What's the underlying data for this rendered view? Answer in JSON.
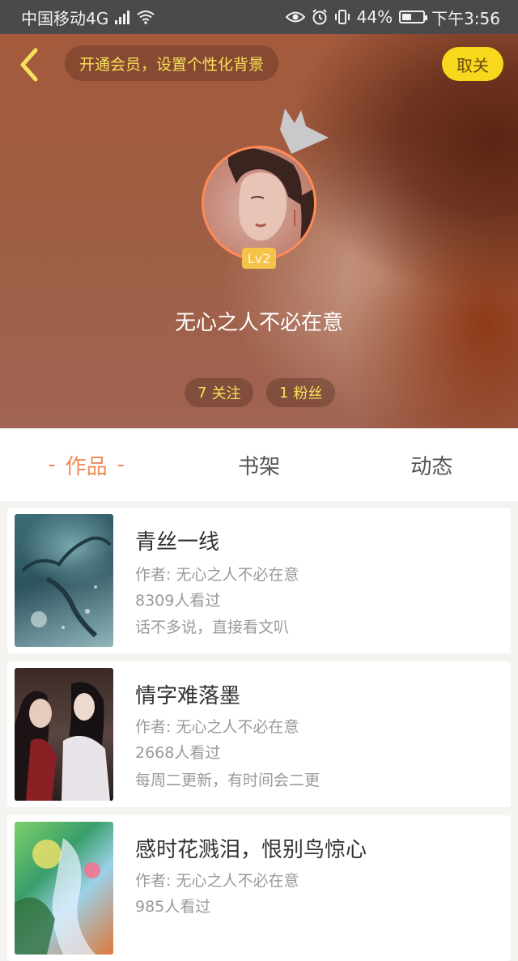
{
  "status_bar": {
    "carrier": "中国移动4G",
    "network_badge": "4G",
    "battery_percent": "44%",
    "battery_level": 0.44,
    "time": "下午3:56",
    "icons": [
      "signal-icon",
      "wifi-icon",
      "eye-icon",
      "alarm-icon",
      "vibrate-icon",
      "battery-icon"
    ]
  },
  "header": {
    "vip_prompt": "开通会员，设置个性化背景",
    "follow_button": "取关",
    "level_badge": "Lv2",
    "username": "无心之人不必在意",
    "following": {
      "count": "7",
      "label": "关注"
    },
    "followers": {
      "count": "1",
      "label": "粉丝"
    }
  },
  "tabs": [
    {
      "label": "作品",
      "active": true,
      "decoration": "-"
    },
    {
      "label": "书架",
      "active": false
    },
    {
      "label": "动态",
      "active": false
    }
  ],
  "works": [
    {
      "title": "青丝一线",
      "author": "作者: 无心之人不必在意",
      "views": "8309人看过",
      "description": "话不多说，直接看文叭"
    },
    {
      "title": "情字难落墨",
      "author": "作者: 无心之人不必在意",
      "views": "2668人看过",
      "description": "每周二更新，有时间会二更"
    },
    {
      "title": "感时花溅泪，恨别鸟惊心",
      "author": "作者: 无心之人不必在意",
      "views": "985人看过",
      "description": ""
    }
  ],
  "colors": {
    "accent": "#f08a55",
    "highlight_yellow": "#f8e15a",
    "follow_button_bg": "#f8d81c",
    "status_bar_bg": "#4a4a4c",
    "page_bg": "#f4f3ef"
  }
}
